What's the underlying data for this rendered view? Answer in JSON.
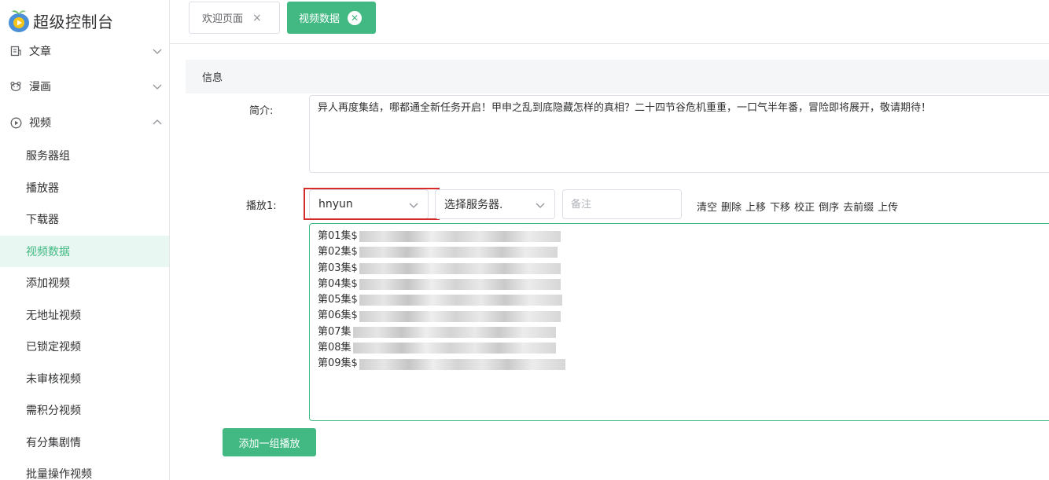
{
  "app": {
    "title": "超级控制台"
  },
  "sidebar": {
    "menus": [
      {
        "label": "文章",
        "icon": "document-icon"
      },
      {
        "label": "漫画",
        "icon": "bear-icon"
      },
      {
        "label": "视频",
        "icon": "play-circle-icon"
      }
    ],
    "video_items": [
      "服务器组",
      "播放器",
      "下载器",
      "视频数据",
      "添加视频",
      "无地址视频",
      "已锁定视频",
      "未审核视频",
      "需积分视频",
      "有分集剧情",
      "批量操作视频"
    ],
    "active_item": "视频数据"
  },
  "tabs": [
    {
      "label": "欢迎页面",
      "active": false
    },
    {
      "label": "视频数据",
      "active": true
    }
  ],
  "panel": {
    "header": "信息"
  },
  "form": {
    "intro_label": "简介:",
    "intro_text": "异人再度集结，哪都通全新任务开启！甲申之乱到底隐藏怎样的真相？二十四节谷危机重重，一口气半年番，冒险即将展开，敬请期待！",
    "play_label": "播放1:",
    "player_select": "hnyun",
    "server_select": "选择服务器.",
    "note_placeholder": "备注",
    "actions": [
      "清空",
      "删除",
      "上移",
      "下移",
      "校正",
      "倒序",
      "去前缀",
      "上传"
    ],
    "episodes": [
      "第01集$",
      "第02集$",
      "第03集$",
      "第04集$",
      "第05集$",
      "第06集$",
      "第07集",
      "第08集",
      "第09集$"
    ],
    "add_button": "添加一组播放"
  },
  "colors": {
    "accent": "#42b983",
    "highlight": "#d62b2b"
  }
}
